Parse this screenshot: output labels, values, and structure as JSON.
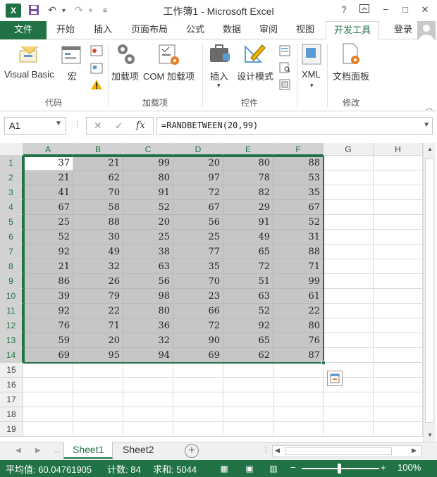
{
  "window": {
    "title": "工作簿1 - Microsoft Excel",
    "help_label": "?",
    "min_label": "−",
    "restore_label": "□",
    "close_label": "✕"
  },
  "quick_access": [
    "save-icon",
    "undo-icon",
    "redo-icon",
    "customize-icon"
  ],
  "tabs": [
    {
      "label": "文件",
      "kind": "file"
    },
    {
      "label": "开始"
    },
    {
      "label": "插入"
    },
    {
      "label": "页面布局"
    },
    {
      "label": "公式"
    },
    {
      "label": "数据"
    },
    {
      "label": "审阅"
    },
    {
      "label": "视图"
    },
    {
      "label": "开发工具",
      "active": true
    }
  ],
  "login_label": "登录",
  "ribbon": {
    "groups": [
      {
        "label": "代码",
        "buttons": [
          "Visual Basic",
          "宏"
        ]
      },
      {
        "label": "加载项",
        "buttons": [
          "加载项",
          "COM 加载项"
        ]
      },
      {
        "label": "控件",
        "buttons": [
          "插入",
          "设计模式"
        ]
      },
      {
        "label": "",
        "buttons": [
          "XML"
        ]
      },
      {
        "label": "修改",
        "buttons": [
          "文档面板"
        ]
      }
    ]
  },
  "formula_bar": {
    "name_box": "A1",
    "cancel": "✕",
    "enter": "✓",
    "fx": "fx",
    "formula": "=RANDBETWEEN(20,99)"
  },
  "columns": [
    "A",
    "B",
    "C",
    "D",
    "E",
    "F",
    "G",
    "H"
  ],
  "selected_columns": [
    "A",
    "B",
    "C",
    "D",
    "E",
    "F"
  ],
  "rows": [
    1,
    2,
    3,
    4,
    5,
    6,
    7,
    8,
    9,
    10,
    11,
    12,
    13,
    14,
    15,
    16,
    17,
    18,
    19
  ],
  "selected_rows": 14,
  "cells": [
    [
      37,
      21,
      99,
      20,
      80,
      88
    ],
    [
      21,
      62,
      80,
      97,
      78,
      53
    ],
    [
      41,
      70,
      91,
      72,
      82,
      35
    ],
    [
      67,
      58,
      52,
      67,
      29,
      67
    ],
    [
      25,
      88,
      20,
      56,
      91,
      52
    ],
    [
      52,
      30,
      25,
      25,
      49,
      31
    ],
    [
      92,
      49,
      38,
      77,
      65,
      88
    ],
    [
      21,
      32,
      63,
      35,
      72,
      71
    ],
    [
      86,
      26,
      56,
      70,
      51,
      99
    ],
    [
      39,
      79,
      98,
      23,
      63,
      61
    ],
    [
      92,
      22,
      80,
      66,
      52,
      22
    ],
    [
      76,
      71,
      36,
      72,
      92,
      80
    ],
    [
      59,
      20,
      32,
      90,
      65,
      76
    ],
    [
      69,
      95,
      94,
      69,
      62,
      87
    ]
  ],
  "sheets": [
    {
      "label": "Sheet1",
      "active": true
    },
    {
      "label": "Sheet2"
    }
  ],
  "add_sheet_label": "+",
  "status": {
    "average": "平均值: 60.04761905",
    "count": "计数: 84",
    "sum": "求和: 5044",
    "zoom_minus": "−",
    "zoom_plus": "+",
    "zoom": "100%"
  },
  "colors": {
    "accent": "#217346",
    "selection": "#c6c6c6"
  }
}
